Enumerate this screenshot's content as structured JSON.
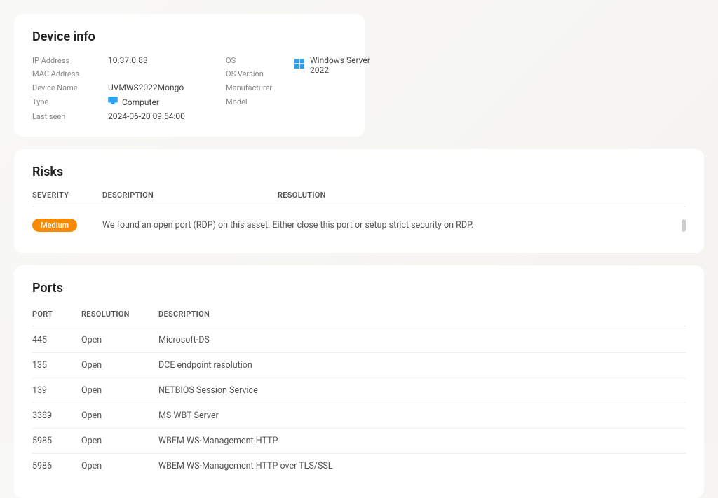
{
  "deviceInfo": {
    "title": "Device info",
    "labels": {
      "ipAddress": "IP Address",
      "macAddress": "MAC Address",
      "deviceName": "Device Name",
      "type": "Type",
      "lastSeen": "Last seen",
      "os": "OS",
      "osVersion": "OS Version",
      "manufacturer": "Manufacturer",
      "model": "Model"
    },
    "values": {
      "ipAddress": "10.37.0.83",
      "macAddress": "",
      "deviceName": "UVMWS2022Mongo",
      "type": "Computer",
      "lastSeen": "2024-06-20 09:54:00",
      "os": "Windows Server 2022",
      "osVersion": "",
      "manufacturer": "",
      "model": ""
    }
  },
  "risks": {
    "title": "Risks",
    "headers": {
      "severity": "SEVERITY",
      "description": "DESCRIPTION",
      "resolution": "RESOLUTION"
    },
    "rows": [
      {
        "severity": "Medium",
        "description": "We found an open port (RDP) on this asset. Either close this port or setup strict security on RDP."
      }
    ]
  },
  "ports": {
    "title": "Ports",
    "headers": {
      "port": "PORT",
      "resolution": "RESOLUTION",
      "description": "DESCRIPTION"
    },
    "rows": [
      {
        "port": "445",
        "resolution": "Open",
        "description": "Microsoft-DS"
      },
      {
        "port": "135",
        "resolution": "Open",
        "description": "DCE endpoint resolution"
      },
      {
        "port": "139",
        "resolution": "Open",
        "description": "NETBIOS Session Service"
      },
      {
        "port": "3389",
        "resolution": "Open",
        "description": "MS WBT Server"
      },
      {
        "port": "5985",
        "resolution": "Open",
        "description": "WBEM WS-Management HTTP"
      },
      {
        "port": "5986",
        "resolution": "Open",
        "description": "WBEM WS-Management HTTP over TLS/SSL"
      }
    ]
  }
}
